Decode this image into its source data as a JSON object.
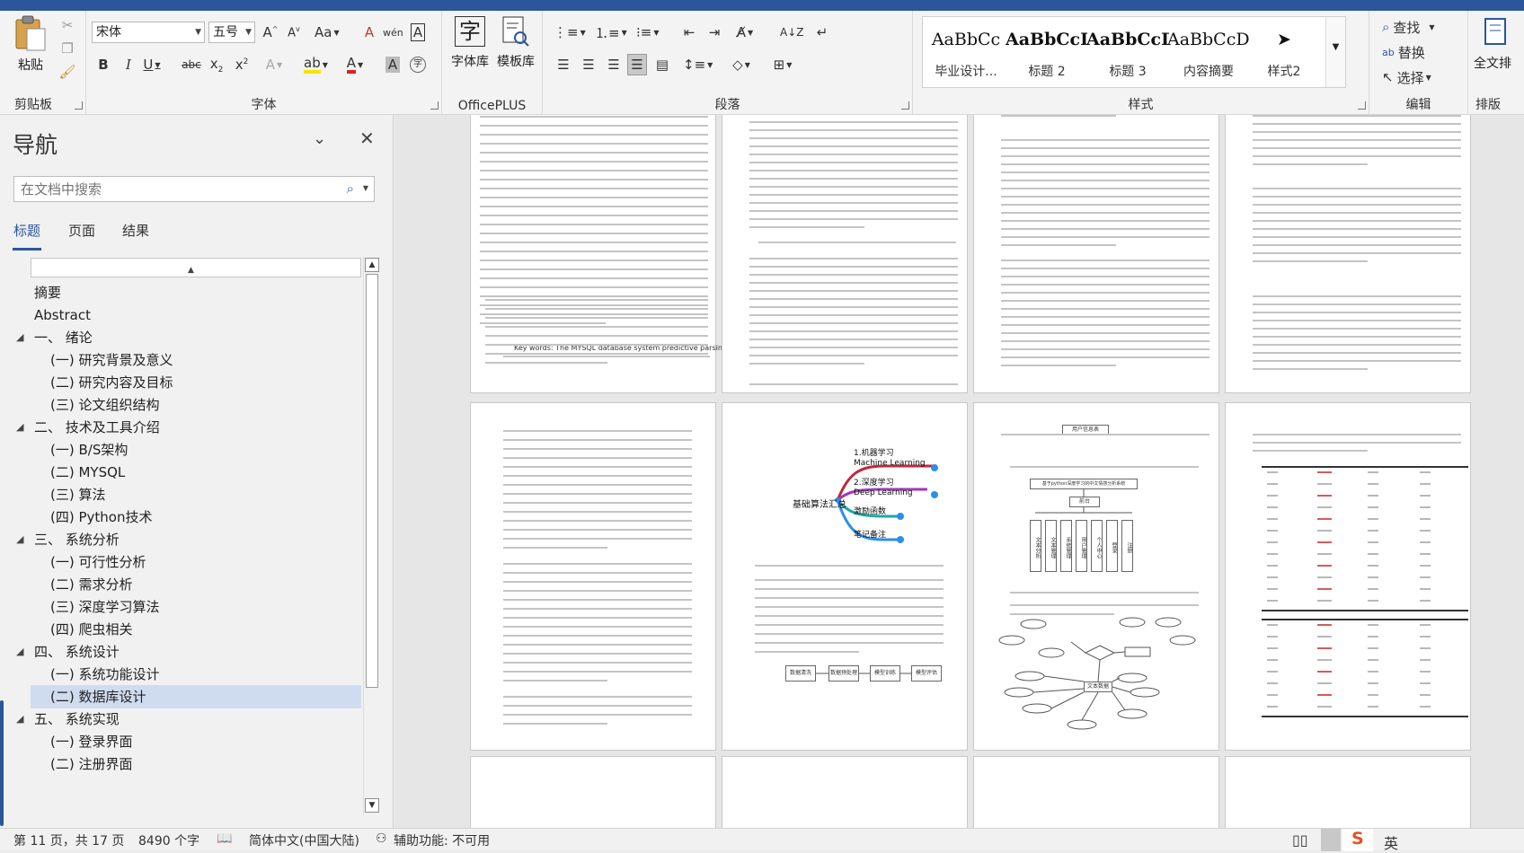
{
  "ribbon": {
    "clipboard": {
      "paste_label": "粘贴",
      "group_label": "剪贴板"
    },
    "font": {
      "font_name": "宋体",
      "font_size": "五号",
      "change_case": "Aa",
      "pinyin": "wén",
      "group_label": "字体"
    },
    "officeplus": {
      "font_lib": "字体库",
      "template_lib": "模板库",
      "group_label": "OfficePLUS"
    },
    "paragraph": {
      "group_label": "段落"
    },
    "styles": {
      "group_label": "样式",
      "items": [
        {
          "preview": "AaBbCc",
          "name": "毕业设计..."
        },
        {
          "preview": "AaBbCcI",
          "name": "标题 2"
        },
        {
          "preview": "AaBbCcD",
          "name": "标题 3"
        },
        {
          "preview": "AaBbCcDc",
          "name": "内容摘要"
        },
        {
          "preview": "",
          "name": "样式2"
        }
      ]
    },
    "editing": {
      "find": "查找",
      "replace": "替换",
      "select": "选择",
      "group_label": "编辑"
    },
    "layout": {
      "full_layout": "全文排",
      "group_label": "排版"
    }
  },
  "nav": {
    "title": "导航",
    "search_placeholder": "在文档中搜索",
    "tabs": [
      "标题",
      "页面",
      "结果"
    ],
    "outline": [
      {
        "label": "摘要",
        "level": 1,
        "arrow": false
      },
      {
        "label": "Abstract",
        "level": 1,
        "arrow": false
      },
      {
        "label": "一、 绪论",
        "level": 1,
        "arrow": true
      },
      {
        "label": "(一) 研究背景及意义",
        "level": 2,
        "arrow": false
      },
      {
        "label": "(二) 研究内容及目标",
        "level": 2,
        "arrow": false
      },
      {
        "label": "(三) 论文组织结构",
        "level": 2,
        "arrow": false
      },
      {
        "label": "二、 技术及工具介绍",
        "level": 1,
        "arrow": true
      },
      {
        "label": "(一) B/S架构",
        "level": 2,
        "arrow": false
      },
      {
        "label": "(二) MYSQL",
        "level": 2,
        "arrow": false
      },
      {
        "label": "(三) 算法",
        "level": 2,
        "arrow": false
      },
      {
        "label": "(四) Python技术",
        "level": 2,
        "arrow": false
      },
      {
        "label": "三、 系统分析",
        "level": 1,
        "arrow": true
      },
      {
        "label": "(一) 可行性分析",
        "level": 2,
        "arrow": false
      },
      {
        "label": "(二) 需求分析",
        "level": 2,
        "arrow": false
      },
      {
        "label": "(三) 深度学习算法",
        "level": 2,
        "arrow": false
      },
      {
        "label": "(四) 爬虫相关",
        "level": 2,
        "arrow": false
      },
      {
        "label": "四、 系统设计",
        "level": 1,
        "arrow": true
      },
      {
        "label": "(一) 系统功能设计",
        "level": 2,
        "arrow": false
      },
      {
        "label": "(二) 数据库设计",
        "level": 2,
        "arrow": false,
        "selected": true
      },
      {
        "label": "五、 系统实现",
        "level": 1,
        "arrow": true
      },
      {
        "label": "(一) 登录界面",
        "level": 2,
        "arrow": false
      },
      {
        "label": "(二) 注册界面",
        "level": 2,
        "arrow": false
      }
    ]
  },
  "document": {
    "page1": {
      "keywords": "Key words:    The MYSQL database system predictive parsing python technology"
    },
    "page7": {
      "mind_root": "基础算法汇总",
      "mind_nodes": [
        {
          "line1": "1.机器学习",
          "line2": "Machine Learning"
        },
        {
          "line1": "2.深度学习",
          "line2": "Deep Learning"
        },
        {
          "line1": "激励函数",
          "line2": ""
        },
        {
          "line1": "笔记备注",
          "line2": ""
        }
      ],
      "flow_boxes": [
        "数据清洗",
        "数据预处理",
        "模型训练",
        "模型评估"
      ]
    },
    "page8": {
      "top_box": "基于python深度学习的中文情感分析系统",
      "mid_box": "前台",
      "leaf_boxes": [
        "文本分析",
        "文本管理",
        "系统管理",
        "用户管理",
        "个人中心",
        "登录",
        "注册"
      ],
      "er_center": "文本数据",
      "er_left_center": "用户信息表"
    }
  },
  "status": {
    "page": "第 11 页，共 17 页",
    "words": "8490 个字",
    "language": "简体中文(中国大陆)",
    "accessibility": "辅助功能: 不可用",
    "ime": "英"
  },
  "colors": {
    "accent": "#2b579a",
    "selected_outline": "#cfdcf0",
    "mind_red": "#c0283c",
    "mind_purple": "#9b3cb4",
    "mind_teal": "#1ba8a8",
    "mind_blue": "#2d8ee8"
  }
}
